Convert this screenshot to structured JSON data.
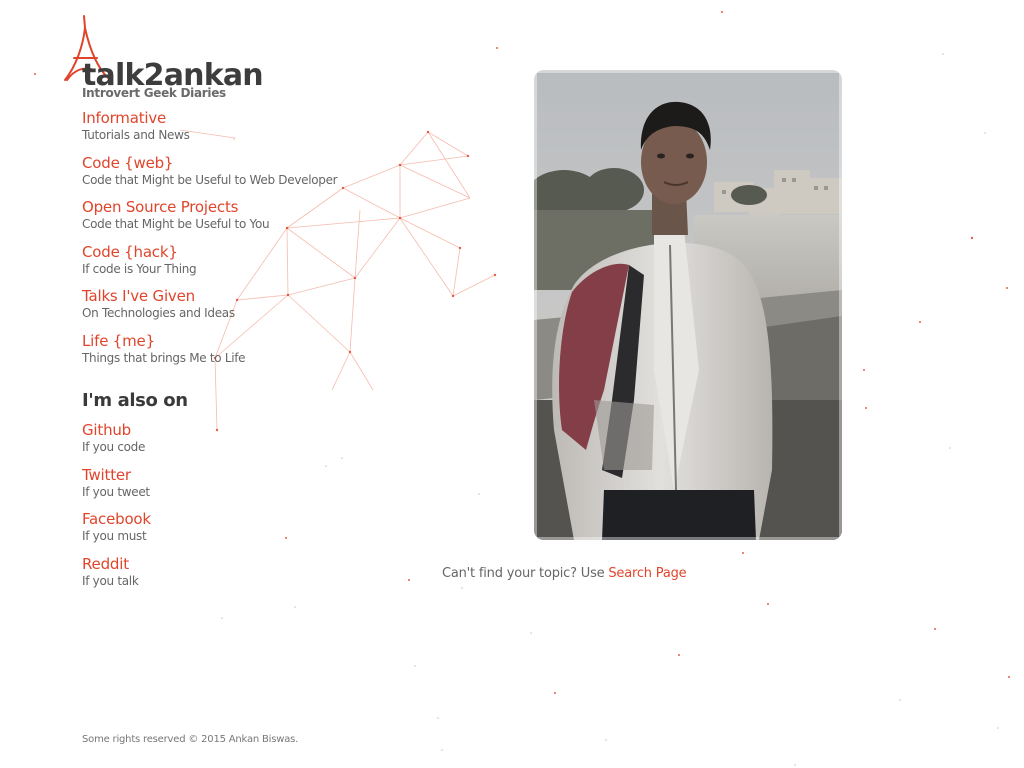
{
  "brand": {
    "title": "talk2ankan",
    "subtitle": "Introvert Geek Diaries",
    "accent_color": "#e0452c"
  },
  "nav": [
    {
      "title": "Informative",
      "desc": "Tutorials and News"
    },
    {
      "title": "Code {web}",
      "desc": "Code that Might be Useful to Web Developer"
    },
    {
      "title": "Open Source Projects",
      "desc": "Code that Might be Useful to You"
    },
    {
      "title": "Code {hack}",
      "desc": "If code is Your Thing"
    },
    {
      "title": "Talks I've Given",
      "desc": "On Technologies and Ideas"
    },
    {
      "title": "Life {me}",
      "desc": "Things that brings Me to Life"
    }
  ],
  "also_on": {
    "heading": "I'm also on",
    "items": [
      {
        "title": "Github",
        "desc": "If you code"
      },
      {
        "title": "Twitter",
        "desc": "If you tweet"
      },
      {
        "title": "Facebook",
        "desc": "If you must"
      },
      {
        "title": "Reddit",
        "desc": "If you talk"
      }
    ]
  },
  "search_note": {
    "text": "Can't find your topic? Use ",
    "link_label": "Search Page"
  },
  "footer": {
    "text": "Some rights reserved © 2015 Ankan Biswas."
  },
  "icons": {
    "logo": "eiffel-tower-icon"
  }
}
